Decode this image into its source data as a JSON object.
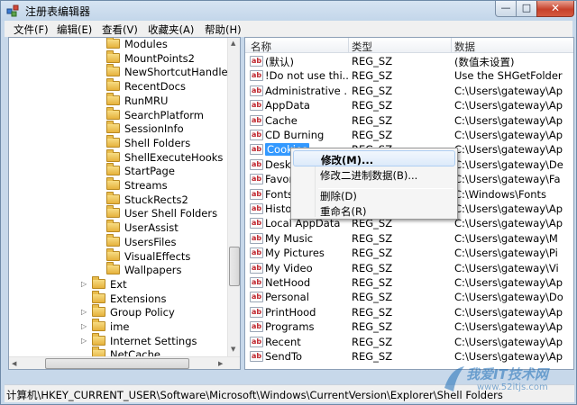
{
  "window": {
    "title": "注册表编辑器",
    "minimize": "—",
    "maximize": "□",
    "close": "✕"
  },
  "menu": [
    "文件(F)",
    "编辑(E)",
    "查看(V)",
    "收藏夹(A)",
    "帮助(H)"
  ],
  "tree": {
    "subitems": [
      "Modules",
      "MountPoints2",
      "NewShortcutHandler",
      "RecentDocs",
      "RunMRU",
      "SearchPlatform",
      "SessionInfo",
      "Shell Folders",
      "ShellExecuteHooks",
      "StartPage",
      "Streams",
      "StuckRects2",
      "User Shell Folders",
      "UserAssist",
      "UsersFiles",
      "VisualEffects",
      "Wallpapers"
    ],
    "items": [
      "Ext",
      "Extensions",
      "Group Policy",
      "ime",
      "Internet Settings",
      "NetCache",
      "Policies"
    ]
  },
  "list": {
    "headers": {
      "name": "名称",
      "type": "类型",
      "data": "数据"
    },
    "rows": [
      {
        "name": "(默认)",
        "type": "REG_SZ",
        "data": "(数值未设置)"
      },
      {
        "name": "!Do not use thi...",
        "type": "REG_SZ",
        "data": "Use the SHGetFolder"
      },
      {
        "name": "Administrative ...",
        "type": "REG_SZ",
        "data": "C:\\Users\\gateway\\Ap"
      },
      {
        "name": "AppData",
        "type": "REG_SZ",
        "data": "C:\\Users\\gateway\\Ap"
      },
      {
        "name": "Cache",
        "type": "REG_SZ",
        "data": "C:\\Users\\gateway\\Ap"
      },
      {
        "name": "CD Burning",
        "type": "REG_SZ",
        "data": "C:\\Users\\gateway\\Ap"
      },
      {
        "name": "Cookies",
        "type": "REG_SZ",
        "data": "C:\\Users\\gateway\\Ap"
      },
      {
        "name": "Deskt",
        "type": "REG_SZ",
        "data": "C:\\Users\\gateway\\De"
      },
      {
        "name": "Favor",
        "type": "REG_SZ",
        "data": "C:\\Users\\gateway\\Fa"
      },
      {
        "name": "Fonts",
        "type": "REG_SZ",
        "data": "C:\\Windows\\Fonts"
      },
      {
        "name": "Histo",
        "type": "REG_SZ",
        "data": "C:\\Users\\gateway\\Ap"
      },
      {
        "name": "Local AppData",
        "type": "REG_SZ",
        "data": "C:\\Users\\gateway\\Ap"
      },
      {
        "name": "My Music",
        "type": "REG_SZ",
        "data": "C:\\Users\\gateway\\M"
      },
      {
        "name": "My Pictures",
        "type": "REG_SZ",
        "data": "C:\\Users\\gateway\\Pi"
      },
      {
        "name": "My Video",
        "type": "REG_SZ",
        "data": "C:\\Users\\gateway\\Vi"
      },
      {
        "name": "NetHood",
        "type": "REG_SZ",
        "data": "C:\\Users\\gateway\\Ap"
      },
      {
        "name": "Personal",
        "type": "REG_SZ",
        "data": "C:\\Users\\gateway\\Do"
      },
      {
        "name": "PrintHood",
        "type": "REG_SZ",
        "data": "C:\\Users\\gateway\\Ap"
      },
      {
        "name": "Programs",
        "type": "REG_SZ",
        "data": "C:\\Users\\gateway\\Ap"
      },
      {
        "name": "Recent",
        "type": "REG_SZ",
        "data": "C:\\Users\\gateway\\Ap"
      },
      {
        "name": "SendTo",
        "type": "REG_SZ",
        "data": "C:\\Users\\gateway\\Ap"
      }
    ],
    "icon_label": "ab"
  },
  "context_menu": [
    "修改(M)...",
    "修改二进制数据(B)...",
    "删除(D)",
    "重命名(R)"
  ],
  "status": "计算机\\HKEY_CURRENT_USER\\Software\\Microsoft\\Windows\\CurrentVersion\\Explorer\\Shell Folders",
  "watermark": {
    "text": "我爱IT技术网",
    "url": "www.52itjs.com"
  }
}
